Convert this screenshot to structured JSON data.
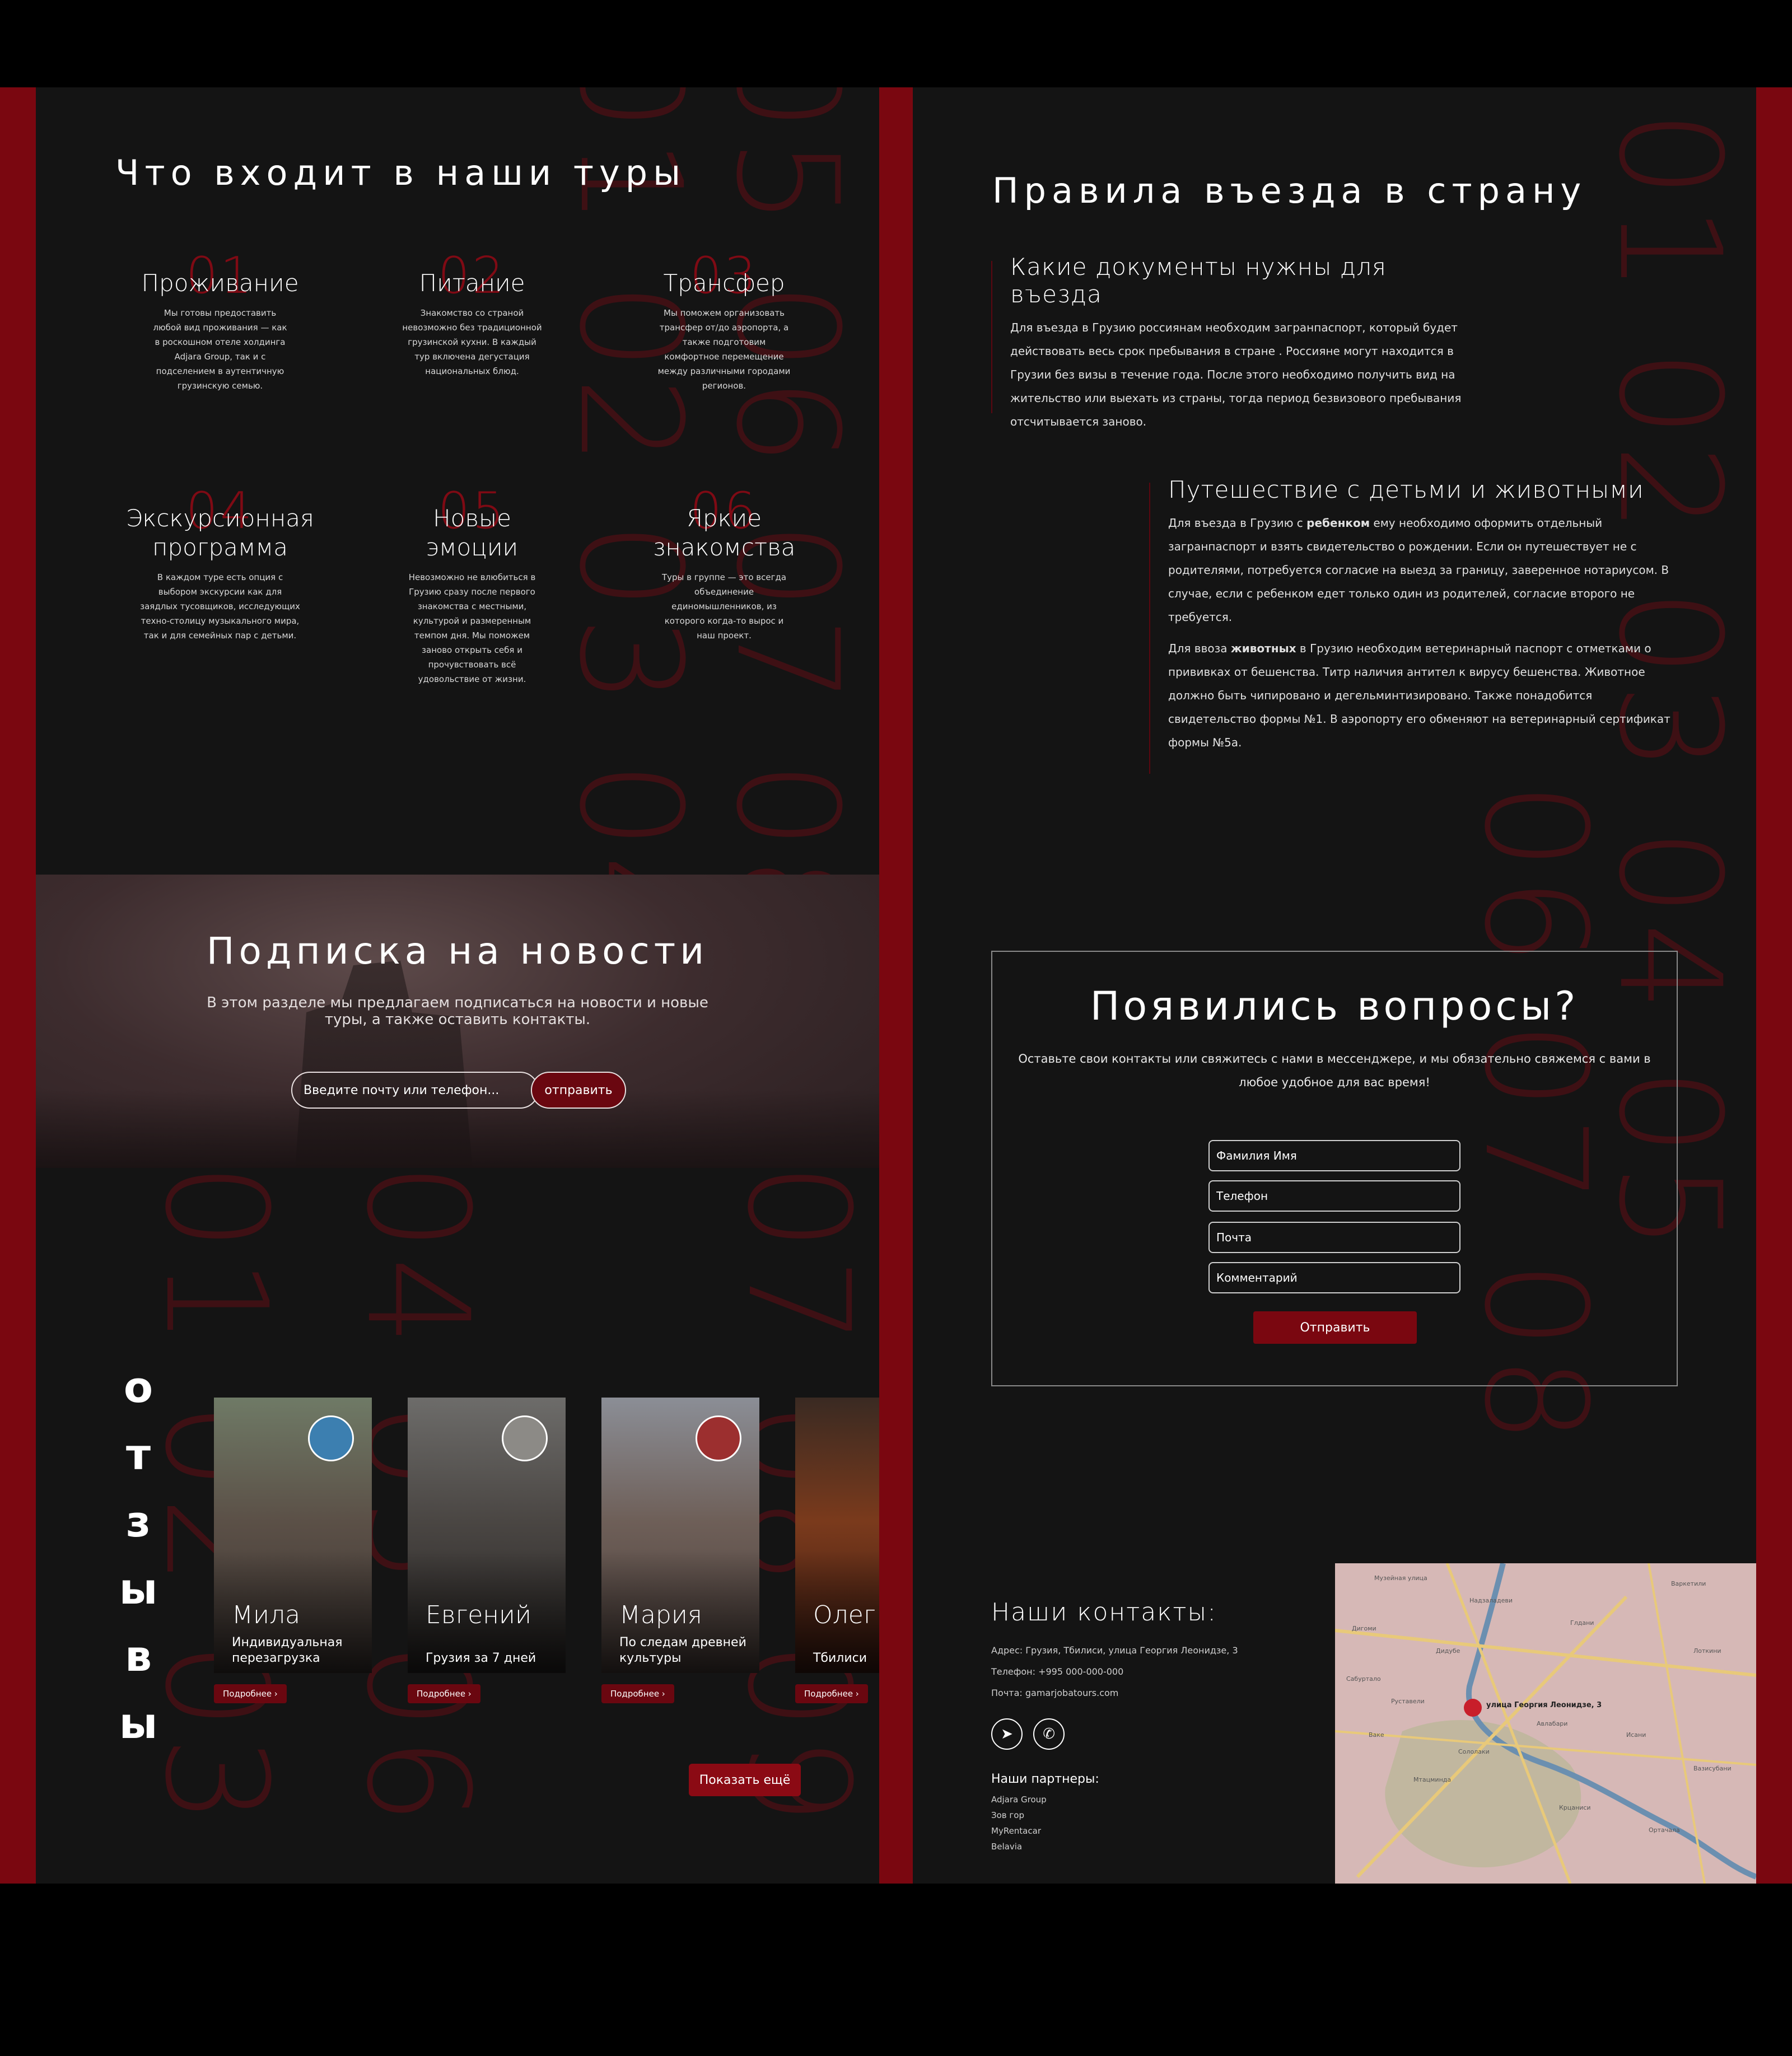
{
  "tours": {
    "heading": "Что входит в наши туры",
    "items": [
      {
        "num": "01",
        "title": "Проживание",
        "desc": "Мы готовы предоставить любой вид проживания — как в роскошном отеле холдинга Adjara Group, так и с подселением в аутентичную грузинскую семью."
      },
      {
        "num": "02",
        "title": "Питание",
        "desc": "Знакомство со страной невозможно без традиционной грузинской кухни. В каждый тур включена дегустация национальных блюд."
      },
      {
        "num": "03",
        "title": "Трансфер",
        "desc": "Мы поможем организовать трансфер от/до аэропорта, а также подготовим комфортное перемещение между различными городами регионов."
      },
      {
        "num": "04",
        "title": "Экскурсионная программа",
        "desc": "В каждом туре есть опция с выбором экскурсии как для заядлых тусовщиков, исследующих техно-столицу музыкального мира, так и для семейных пар с детьми."
      },
      {
        "num": "05",
        "title": "Новые эмоции",
        "desc": "Невозможно не влюбиться в Грузию сразу после первого знакомства с местными, культурой и размеренным темпом дня. Мы поможем заново открыть себя и прочувствовать всё удовольствие от жизни."
      },
      {
        "num": "06",
        "title": "Яркие знакомства",
        "desc": "Туры в группе — это всегда объединение единомышленников, из которого когда-то вырос и наш проект."
      }
    ]
  },
  "subscribe": {
    "heading": "Подписка на новости",
    "text": "В этом разделе мы предлагаем подписаться на новости и новые туры, а также оставить контакты.",
    "placeholder": "Введите почту или телефон...",
    "button": "отправить"
  },
  "reviews": {
    "letters": [
      "о",
      "т",
      "з",
      "ы",
      "в",
      "ы"
    ],
    "cards": [
      {
        "name": "Мила",
        "sub": "Индивидуальная перезагрузка",
        "more": "Подробнее  ›",
        "photo": "#5b5047",
        "avatar": "#3c7fb0"
      },
      {
        "name": "Евгений",
        "sub": "Грузия за 7 дней",
        "more": "Подробнее  ›",
        "photo": "#4a4643",
        "avatar": "#8c8a86"
      },
      {
        "name": "Мария",
        "sub": "По следам древней культуры",
        "more": "Подробнее  ›",
        "photo": "#6e5f58",
        "avatar": "#9c2f2f"
      },
      {
        "name": "Олег",
        "sub": "Тбилиси",
        "more": "Подробнее  ›",
        "photo": "#5a2a1c",
        "avatar": "#000000"
      }
    ],
    "show_more": "Показать ещё"
  },
  "rules": {
    "heading": "Правила въезда в страну",
    "docs_title": "Какие документы нужны для въезда",
    "docs_text": "Для въезда в Грузию россиянам необходим загранпаспорт, который будет действовать весь срок пребывания в стране . Россияне могут находится в Грузии без визы в течение года. После этого необходимо получить вид на жительство или выехать из страны, тогда период безвизового пребывания отсчитывается заново.",
    "kids_title": "Путешествие с детьми и животными",
    "kids_pre": "Для въезда в Грузию с ",
    "kids_bold": "ребенком",
    "kids_post": " ему необходимо оформить отдельный загранпаспорт и взять свидетельство о рождении. Если он путешествует не с родителями, потребуется согласие на выезд за границу, заверенное нотариусом. В случае, если с ребенком едет только один из родителей, согласие второго не требуется.",
    "pets_pre": "Для ввоза ",
    "pets_bold": "животных",
    "pets_post": " в Грузию необходим ветеринарный паспорт с отметками о прививках от бешенства. Титр наличия антител к вирусу бешенства. Животное должно быть чипировано и дегельминтизировано. Также понадобится свидетельство формы №1. В аэропорту его обменяют на ветеринарный сертификат формы №5а."
  },
  "questions": {
    "heading": "Появились вопросы?",
    "text": "Оставьте свои контакты или свяжитесь с нами в мессенджере, и мы обязательно свяжемся с вами в любое удобное для вас время!",
    "fields": [
      "Фамилия Имя",
      "Телефон",
      "Почта",
      "Комментарий"
    ],
    "button": "Отправить"
  },
  "contacts": {
    "heading": "Наши контакты:",
    "address": "Адрес: Грузия, Тбилиси, улица Георгия Леонидзе, 3",
    "phone": "Телефон: +995 000-000-000",
    "email": "Почта: gamarjobatours.com",
    "social": [
      "telegram-icon",
      "whatsapp-icon"
    ],
    "partners_heading": "Наши партнеры:",
    "partners": [
      "Adjara Group",
      "Зов гор",
      "MyRentacar",
      "Belavia"
    ]
  },
  "map": {
    "pin_label": "улица Георгия Леонидзе, 3",
    "places": [
      "Музейная улица",
      "Надзаладеви",
      "Варкетили",
      "Дигоми",
      "Дидубе",
      "Глдани",
      "Сололаки",
      "Ваке",
      "Крцаниси",
      "Ортачала",
      "Исани",
      "Авлабари",
      "Мтацминда",
      "Сабуртало",
      "Вазисубани",
      "Руставели",
      "Лоткини"
    ],
    "colors": {
      "land": "#d6b8b6",
      "roads": "#e8c97a",
      "river": "#6b8fb0",
      "park": "#b9b69a",
      "pin": "#c81e2a"
    }
  },
  "colors": {
    "accent": "#7a0710",
    "panel": "#141414",
    "frame": "#7a0710"
  }
}
